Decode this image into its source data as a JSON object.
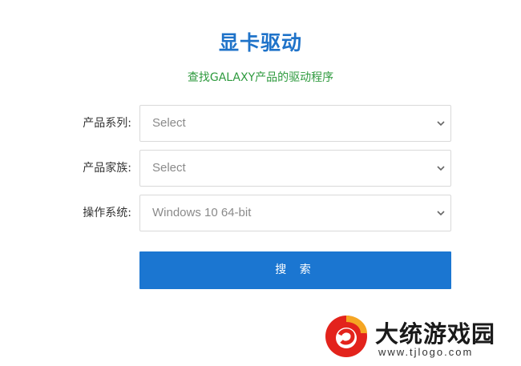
{
  "header": {
    "title": "显卡驱动",
    "subtitle": "查找GALAXY产品的驱动程序"
  },
  "form": {
    "fields": [
      {
        "label": "产品系列:",
        "value": "Select"
      },
      {
        "label": "产品家族:",
        "value": "Select"
      },
      {
        "label": "操作系统:",
        "value": "Windows 10 64-bit"
      }
    ],
    "submit_label": "搜 索"
  },
  "watermark": {
    "site_name": "大统游戏园",
    "url": "www.tjlogo.com"
  },
  "colors": {
    "title": "#1f73c9",
    "subtitle": "#2e9a3e",
    "button": "#1b76d1",
    "border": "#d9d9d9"
  },
  "icons": {
    "select_arrow": "chevron-down-icon",
    "watermark_logo": "red-circle-logo-icon"
  }
}
